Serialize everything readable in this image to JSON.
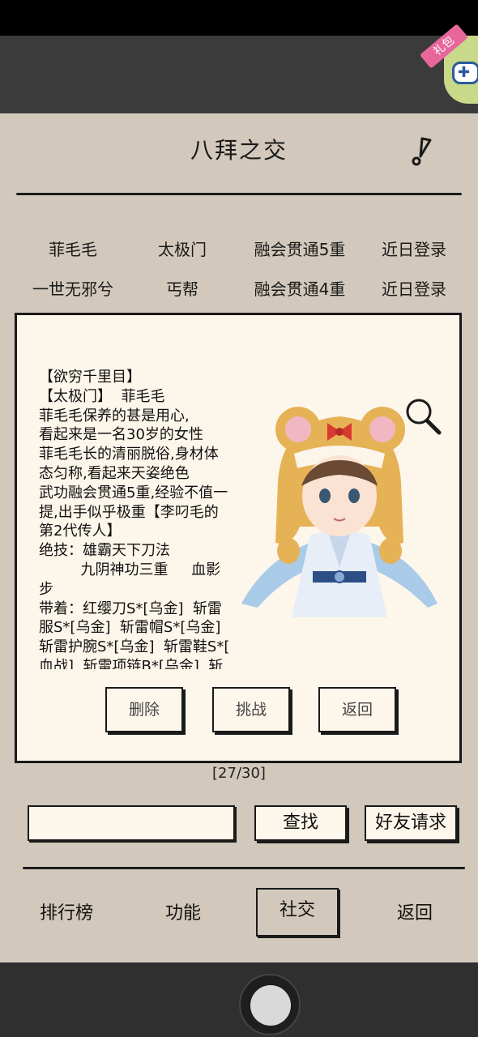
{
  "header": {
    "title": "八拜之交"
  },
  "gift_widget": {
    "ribbon_label": "礼包",
    "icon": "gamepad-icon"
  },
  "friends": [
    {
      "name": "菲毛毛",
      "sect": "太极门",
      "level": "融会贯通5重",
      "status": "近日登录"
    },
    {
      "name": "一世无邪兮",
      "sect": "丐帮",
      "level": "融会贯通4重",
      "status": "近日登录"
    }
  ],
  "profile": {
    "lines": [
      "【欲穷千里目】",
      "【太极门】  菲毛毛",
      "菲毛毛保养的甚是用心,",
      "看起来是一名30岁的女性",
      "菲毛毛长的清丽脱俗,身材体",
      "态匀称,看起来天姿绝色",
      "武功融会贯通5重,经验不值一",
      "提,出手似乎极重【李叼毛的",
      "第2代传人】",
      "绝技：雄霸天下刀法",
      "         九阴神功三重     血影",
      "步",
      "带着：红缨刀S*[乌金]  斩雷",
      "服S*[乌金]  斩雷帽S*[乌金]",
      "斩雷护腕S*[乌金]  斩雷鞋S*[",
      "血战]  斩雷项链B*[乌金]  斩"
    ]
  },
  "dialog_buttons": {
    "delete": "删除",
    "challenge": "挑战",
    "back": "返回"
  },
  "pagination": {
    "text": "[27/30]"
  },
  "search": {
    "input_value": "",
    "find_label": "查找",
    "request_label": "好友请求"
  },
  "bottom_nav": [
    {
      "label": "排行榜",
      "active": false
    },
    {
      "label": "功能",
      "active": false
    },
    {
      "label": "社交",
      "active": true
    },
    {
      "label": "返回",
      "active": false
    }
  ]
}
